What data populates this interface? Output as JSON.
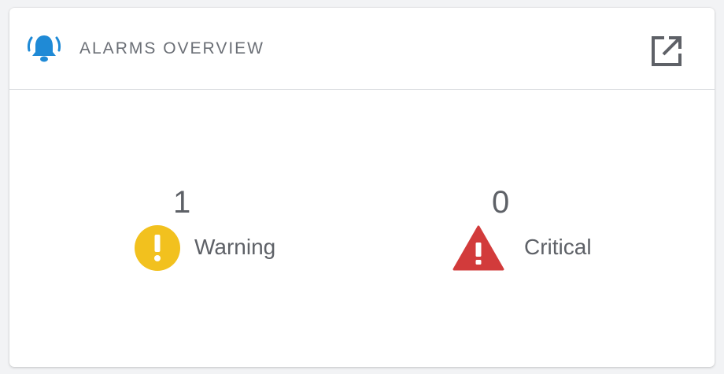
{
  "header": {
    "title": "ALARMS OVERVIEW",
    "icon": "bell-alarm-icon",
    "open_icon": "open-external-icon"
  },
  "stats": {
    "warning": {
      "count": "1",
      "label": "Warning",
      "icon": "warning-circle-icon",
      "color": "#f2c11e"
    },
    "critical": {
      "count": "0",
      "label": "Critical",
      "icon": "critical-triangle-icon",
      "color": "#d23b3b"
    }
  },
  "colors": {
    "accent": "#1f8ad6",
    "text": "#5e6167"
  }
}
